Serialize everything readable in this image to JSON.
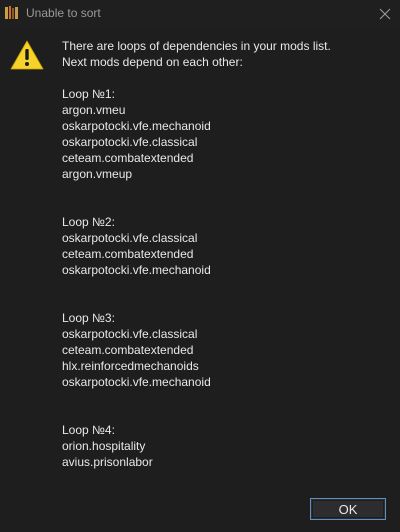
{
  "window": {
    "title": "Unable to sort",
    "app_icon": "books-icon",
    "close_icon": "close-icon"
  },
  "dialog": {
    "icon": "warning-icon",
    "intro_line1": "There are loops of dependencies in your mods list.",
    "intro_line2": "Next mods depend on each other:",
    "loops": [
      {
        "label": "Loop №1:",
        "mods": [
          "argon.vmeu",
          "oskarpotocki.vfe.mechanoid",
          "oskarpotocki.vfe.classical",
          "ceteam.combatextended",
          "argon.vmeup"
        ]
      },
      {
        "label": "Loop №2:",
        "mods": [
          "oskarpotocki.vfe.classical",
          "ceteam.combatextended",
          "oskarpotocki.vfe.mechanoid"
        ]
      },
      {
        "label": "Loop №3:",
        "mods": [
          "oskarpotocki.vfe.classical",
          "ceteam.combatextended",
          "hlx.reinforcedmechanoids",
          "oskarpotocki.vfe.mechanoid"
        ]
      },
      {
        "label": "Loop №4:",
        "mods": [
          "orion.hospitality",
          "avius.prisonlabor"
        ]
      }
    ],
    "ok_label": "OK"
  },
  "colors": {
    "background": "#1e1e1e",
    "text": "#e8e8e8",
    "title_text": "#9a9a9a",
    "warning_yellow": "#f6d22a",
    "button_border": "#5a90c8"
  }
}
